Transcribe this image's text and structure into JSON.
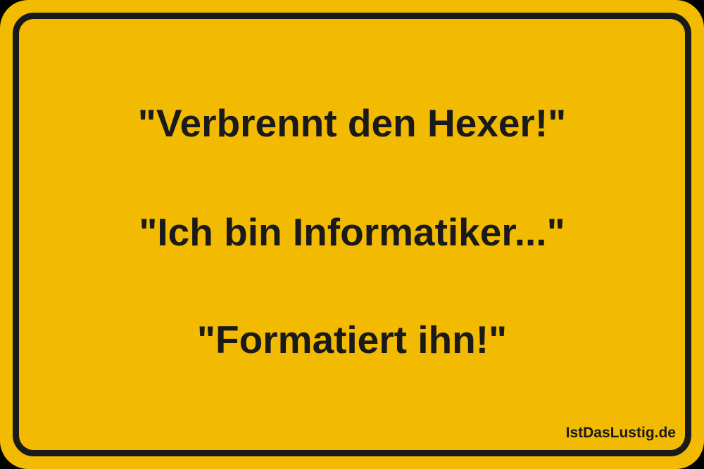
{
  "sign": {
    "background_color": "#F2BA00",
    "border_color": "#1a1a1a",
    "text_color": "#1a1a1a",
    "lines": [
      "\"Verbrennt den Hexer!\"",
      "\"Ich bin Informatiker...\"",
      "\"Formatiert ihn!\""
    ]
  },
  "watermark": "IstDasLustig.de"
}
